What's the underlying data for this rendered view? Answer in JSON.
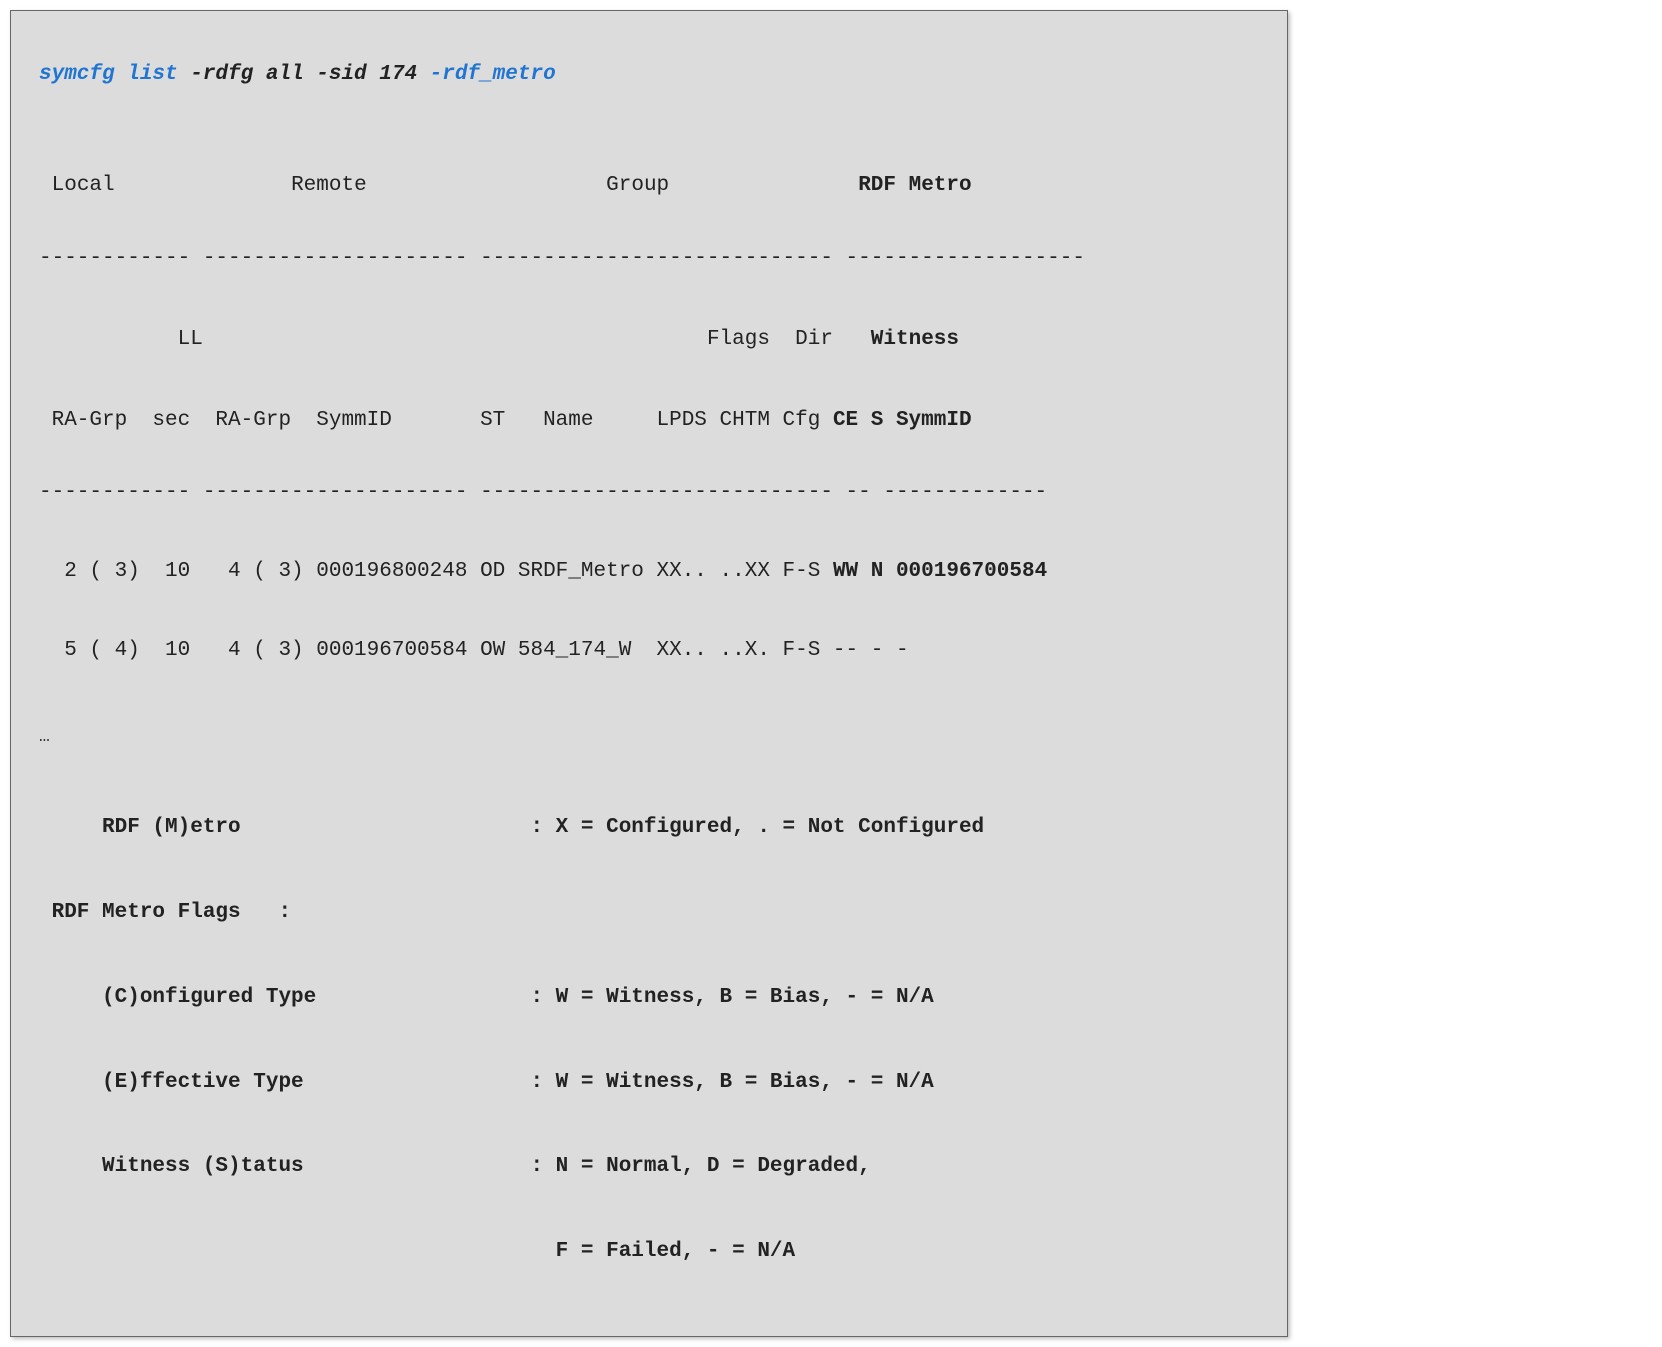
{
  "command": {
    "part1": "symcfg list",
    "part2": " -rdfg all -sid 174 ",
    "part3": "-rdf_metro"
  },
  "section_top": {
    "local": "Local",
    "remote": "Remote",
    "group": "Group",
    "rdf_metro": "RDF Metro"
  },
  "dashes1": "------------ --------------------- ---------------------------- -------------------",
  "sub_hdr1": {
    "ll": "LL",
    "flags": "Flags",
    "dir": "Dir",
    "witness": "Witness"
  },
  "col_hdr": {
    "line": " RA-Grp  sec  RA-Grp  SymmID       ST   Name     LPDS CHTM Cfg ",
    "ce": "CE S SymmID"
  },
  "dashes2": "------------ --------------------- ---------------------------- -- -------------",
  "rows": [
    {
      "left": "  2 ( 3)  10   4 ( 3) 000196800248 OD SRDF_Metro XX.. ..XX F-S ",
      "bold": "WW N 000196700584"
    },
    {
      "left": "  5 ( 4)  10   4 ( 3) 000196700584 OW 584_174_W  XX.. ..X. F-S -- - -",
      "bold": ""
    }
  ],
  "ellipsis": "…",
  "legend": {
    "l1": "     RDF (M)etro                       : X = Configured, . = Not Configured",
    "l2": " RDF Metro Flags   :",
    "l3": "     (C)onfigured Type                 : W = Witness, B = Bias, - = N/A",
    "l4": "     (E)ffective Type                  : W = Witness, B = Bias, - = N/A",
    "l5": "     Witness (S)tatus                  : N = Normal, D = Degraded,",
    "l6": "                                         F = Failed, - = N/A"
  }
}
